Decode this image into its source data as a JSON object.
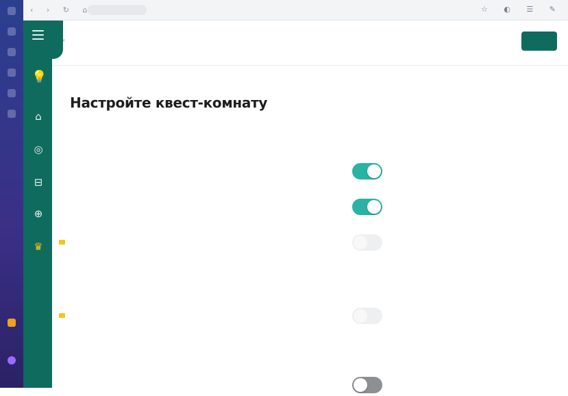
{
  "browser": {
    "nav_glyphs": "‹ › ↻ ⌂",
    "url": "",
    "tab_title": "",
    "icons": "☆ ◐ ☰ ✎"
  },
  "sidebar": {
    "menu_label": "",
    "items": [
      {
        "icon": "home-icon",
        "glyph": "⌂",
        "label": ""
      },
      {
        "icon": "library-icon",
        "glyph": "◎",
        "label": ""
      },
      {
        "icon": "folder-icon",
        "glyph": "⊟",
        "label": ""
      },
      {
        "icon": "add-icon",
        "glyph": "⊕",
        "label": ""
      },
      {
        "icon": "crown-icon",
        "glyph": "♛",
        "label": ""
      }
    ]
  },
  "header": {
    "back_label": "‹",
    "step_title": "",
    "save_label": ""
  },
  "page": {
    "title": "Настройте квест-комнату"
  },
  "sections": [
    {
      "title": "",
      "rows": [
        {
          "label": "",
          "state": "",
          "on": true,
          "disabled": false,
          "premium": false
        },
        {
          "label": "",
          "state": "",
          "on": true,
          "disabled": false,
          "premium": false
        },
        {
          "label": "",
          "state": "",
          "on": false,
          "disabled": true,
          "premium": true
        }
      ]
    },
    {
      "title": "",
      "rows": [
        {
          "label": "",
          "state": "",
          "on": false,
          "disabled": true,
          "premium": true
        }
      ]
    },
    {
      "title": "",
      "rows": [
        {
          "label": "",
          "state": "",
          "on": false,
          "disabled": false,
          "premium": false
        }
      ]
    }
  ],
  "colors": {
    "brand": "#0f6b5e",
    "toggle_on": "#2ab3a4",
    "premium": "#f5c518"
  }
}
